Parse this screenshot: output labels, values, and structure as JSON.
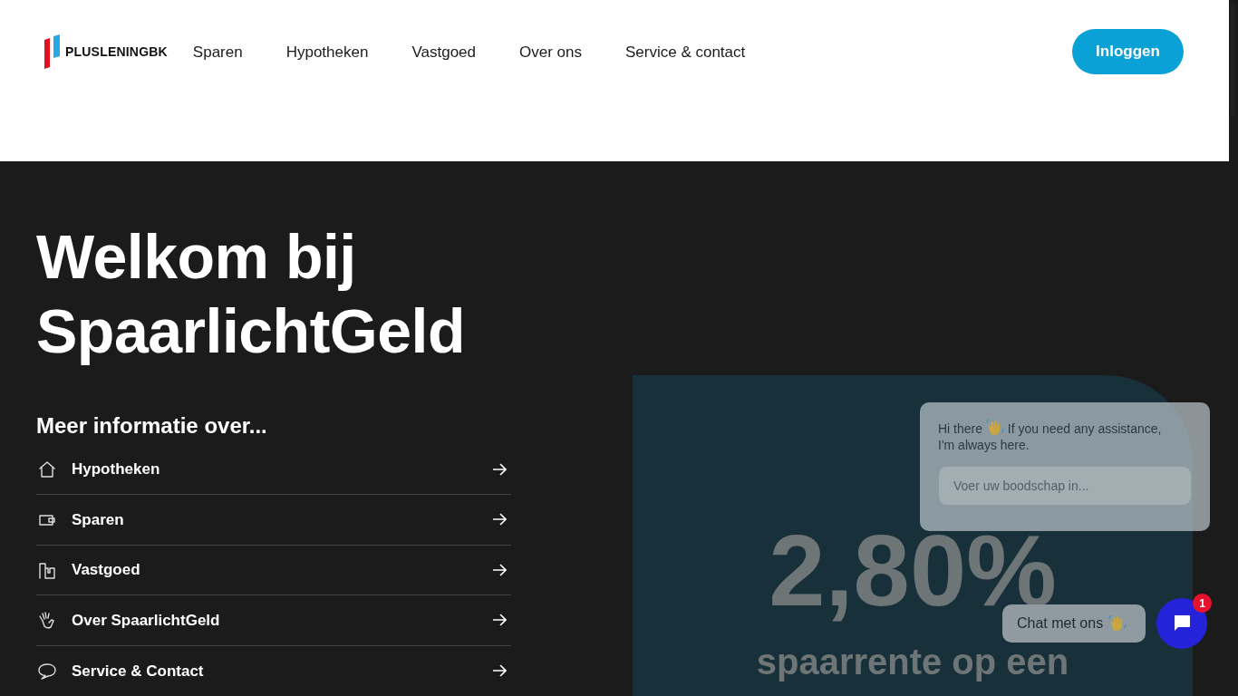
{
  "header": {
    "logo": "PLUSLENINGBK",
    "nav": [
      "Sparen",
      "Hypotheken",
      "Vastgoed",
      "Over ons",
      "Service & contact"
    ],
    "login_button": "Inloggen"
  },
  "hero": {
    "title_lines": [
      "Welkom bij",
      "SpaarlichtGeld"
    ],
    "info_heading": "Meer informatie over...",
    "links": [
      {
        "label": "Hypotheken",
        "kind": "house"
      },
      {
        "label": "Sparen",
        "kind": "wallet"
      },
      {
        "label": "Vastgoed",
        "kind": "building"
      },
      {
        "label": "Over SpaarlichtGeld",
        "kind": "hand"
      },
      {
        "label": "Service & Contact",
        "kind": "speech"
      }
    ]
  },
  "rate_card": {
    "rate": "2,80%",
    "caption": "spaarrente op een"
  },
  "chat": {
    "message_start": "Hi there",
    "message_end": "If you need any assistance,",
    "message_line2": "I'm always here.",
    "placeholder": "Voer uw boodschap in...",
    "button": "Chat met ons",
    "badge": "1"
  }
}
